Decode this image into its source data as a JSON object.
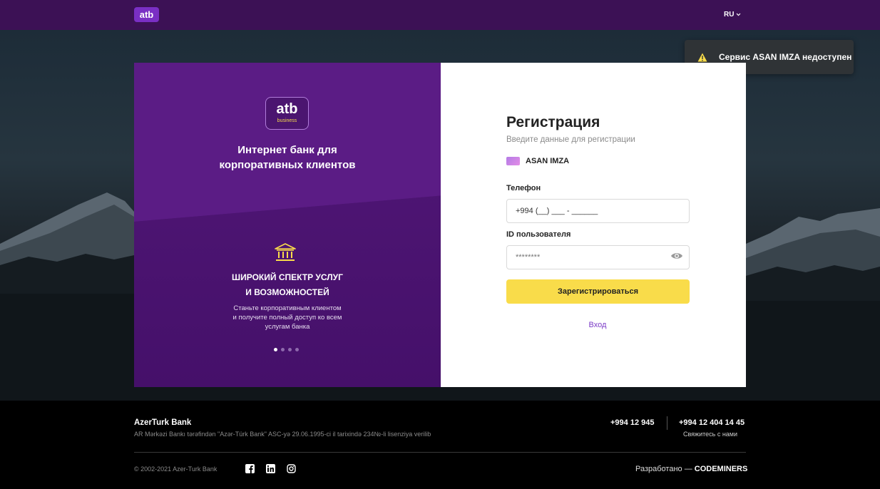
{
  "header": {
    "logo_text": "atb",
    "language": "RU"
  },
  "toast": {
    "message": "Сервис ASAN IMZA недоступен",
    "icon": "warning-icon"
  },
  "promo": {
    "logo_text": "atb",
    "logo_subtext": "business",
    "title_line1": "Интернет банк для",
    "title_line2": "корпоративных клиентов",
    "feature_icon": "bank-building-icon",
    "feature_title_line1": "ШИРОКИЙ СПЕКТР УСЛУГ",
    "feature_title_line2": "И ВОЗМОЖНОСТЕЙ",
    "feature_text_line1": "Станьте корпоративным клиентом",
    "feature_text_line2": "и получите полный доступ ко всем",
    "feature_text_line3": "услугам банка",
    "slide_count": 4,
    "active_slide": 1
  },
  "registration": {
    "title": "Регистрация",
    "subtitle": "Введите данные для регистрации",
    "method_label": "ASAN IMZA",
    "phone_label": "Телефон",
    "phone_value": "+994 (__) ___ - ______",
    "user_id_label": "ID пользователя",
    "user_id_placeholder": "********",
    "register_button": "Зарегистрироваться",
    "login_link": "Вход"
  },
  "footer": {
    "bank_name": "AzerTurk Bank",
    "license": "AR Mərkəzi Bankı tərəfindən \"Azər-Türk Bank\" ASC-yə 29.06.1995-ci il tarixində 234№-li lisenziya verilib",
    "phone_short": "+994 12 945",
    "phone_full": "+994 12 404 14 45",
    "contact_label": "Свяжитесь с нами",
    "copyright": "© 2002-2021 Azer-Turk Bank",
    "developed_by_prefix": "Разработано —",
    "developer": "CODEMINERS"
  },
  "colors": {
    "brand_purple": "#4b1570",
    "accent_yellow": "#f9dc4a",
    "link_purple": "#7b3ac7"
  }
}
